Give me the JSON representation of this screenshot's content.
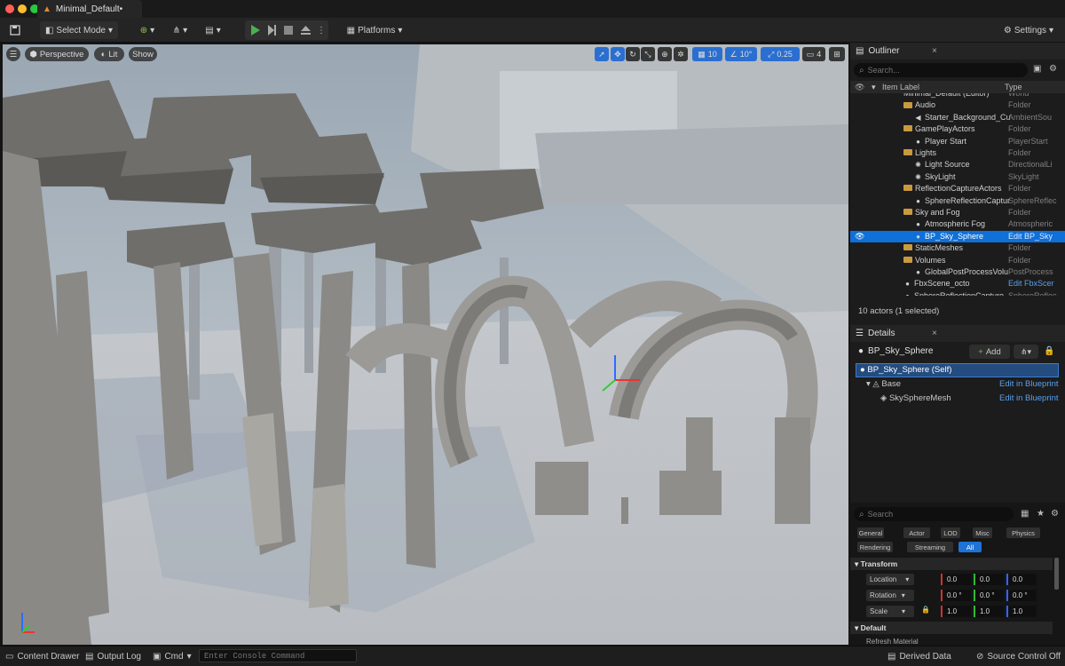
{
  "window": {
    "tab_title": "Minimal_Default•"
  },
  "toolbar": {
    "select_mode": "Select Mode",
    "platforms": "Platforms",
    "settings": "Settings"
  },
  "viewport": {
    "perspective": "Perspective",
    "lit": "Lit",
    "show": "Show",
    "grid_snap": "10",
    "rot_snap": "10°",
    "scale_snap": "0.25",
    "camera_speed": "4"
  },
  "outliner": {
    "title": "Outliner",
    "search_placeholder": "Search...",
    "col_label": "Item Label",
    "col_type": "Type",
    "rows": [
      {
        "name": "Minimal_Default (Editor)",
        "type": "World",
        "indent": 60,
        "kind": "world"
      },
      {
        "name": "Audio",
        "type": "Folder",
        "indent": 60,
        "kind": "folder"
      },
      {
        "name": "Starter_Background_Cu",
        "type": "AmbientSou",
        "indent": 72,
        "kind": "audio"
      },
      {
        "name": "GamePlayActors",
        "type": "Folder",
        "indent": 60,
        "kind": "folder"
      },
      {
        "name": "Player Start",
        "type": "PlayerStart",
        "indent": 72,
        "kind": "actor"
      },
      {
        "name": "Lights",
        "type": "Folder",
        "indent": 60,
        "kind": "folder"
      },
      {
        "name": "Light Source",
        "type": "DirectionalLi",
        "indent": 72,
        "kind": "light"
      },
      {
        "name": "SkyLight",
        "type": "SkyLight",
        "indent": 72,
        "kind": "light"
      },
      {
        "name": "ReflectionCaptureActors",
        "type": "Folder",
        "indent": 60,
        "kind": "folder"
      },
      {
        "name": "SphereReflectionCaptur",
        "type": "SphereReflec",
        "indent": 72,
        "kind": "actor"
      },
      {
        "name": "Sky and Fog",
        "type": "Folder",
        "indent": 60,
        "kind": "folder"
      },
      {
        "name": "Atmospheric Fog",
        "type": "Atmospheric",
        "indent": 72,
        "kind": "actor"
      },
      {
        "name": "BP_Sky_Sphere",
        "type": "Edit BP_Sky",
        "indent": 72,
        "kind": "actor"
      },
      {
        "name": "StaticMeshes",
        "type": "Folder",
        "indent": 60,
        "kind": "folder"
      },
      {
        "name": "Volumes",
        "type": "Folder",
        "indent": 60,
        "kind": "folder"
      },
      {
        "name": "GlobalPostProcessVolu",
        "type": "PostProcess",
        "indent": 72,
        "kind": "actor"
      },
      {
        "name": "FbxScene_octo",
        "type": "Edit FbxScer",
        "indent": 60,
        "kind": "actor"
      },
      {
        "name": "SphereReflectionCapture",
        "type": "SphereReflec",
        "indent": 60,
        "kind": "actor"
      }
    ],
    "selected_index": 12,
    "status": "10 actors (1 selected)"
  },
  "details": {
    "title": "Details",
    "actor_name": "BP_Sky_Sphere",
    "add_label": "Add",
    "self_label": "BP_Sky_Sphere (Self)",
    "base_label": "Base",
    "mesh_label": "SkySphereMesh",
    "edit_bp": "Edit in Blueprint",
    "search_placeholder": "Search",
    "filters": [
      "General",
      "Actor",
      "LOD",
      "Misc",
      "Physics",
      "Rendering",
      "Streaming",
      "All"
    ],
    "transform_header": "Transform",
    "location_label": "Location",
    "rotation_label": "Rotation",
    "scale_label": "Scale",
    "location": [
      "0.0",
      "0.0",
      "0.0"
    ],
    "rotation": [
      "0.0 °",
      "0.0 °",
      "0.0 °"
    ],
    "scale": [
      "1.0",
      "1.0",
      "1.0"
    ],
    "default_header": "Default",
    "refresh_label": "Refresh Material"
  },
  "statusbar": {
    "content_drawer": "Content Drawer",
    "output_log": "Output Log",
    "cmd": "Cmd",
    "console_placeholder": "Enter Console Command",
    "derived_data": "Derived Data",
    "source_control": "Source Control Off"
  },
  "colors": {
    "accent": "#2a6fd0",
    "folder": "#c99a3d",
    "play": "#4caf50"
  }
}
